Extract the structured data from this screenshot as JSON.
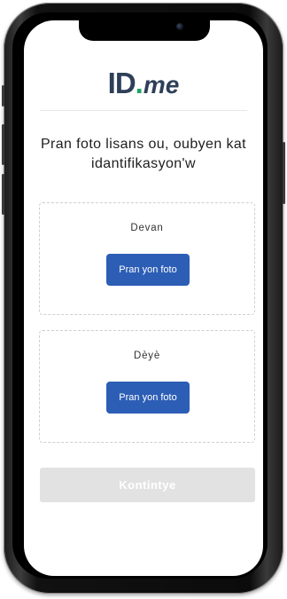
{
  "brand": {
    "logo_id": "ID",
    "logo_dot": ".",
    "logo_me": "me",
    "accent_color": "#21a366",
    "primary_color": "#2e3f58"
  },
  "prompt": {
    "headline": "Pran foto lisans ou, oubyen kat idantifikasyon'w"
  },
  "upload_sections": [
    {
      "label": "Devan",
      "button_label": "Pran yon foto"
    },
    {
      "label": "Dèyè",
      "button_label": "Pran yon foto"
    }
  ],
  "actions": {
    "continue_label": "Kontintye",
    "continue_enabled": false,
    "button_color": "#2d5eb5",
    "disabled_color": "#e2e2e2"
  },
  "device": {
    "camera_icon": "front-camera-icon"
  }
}
